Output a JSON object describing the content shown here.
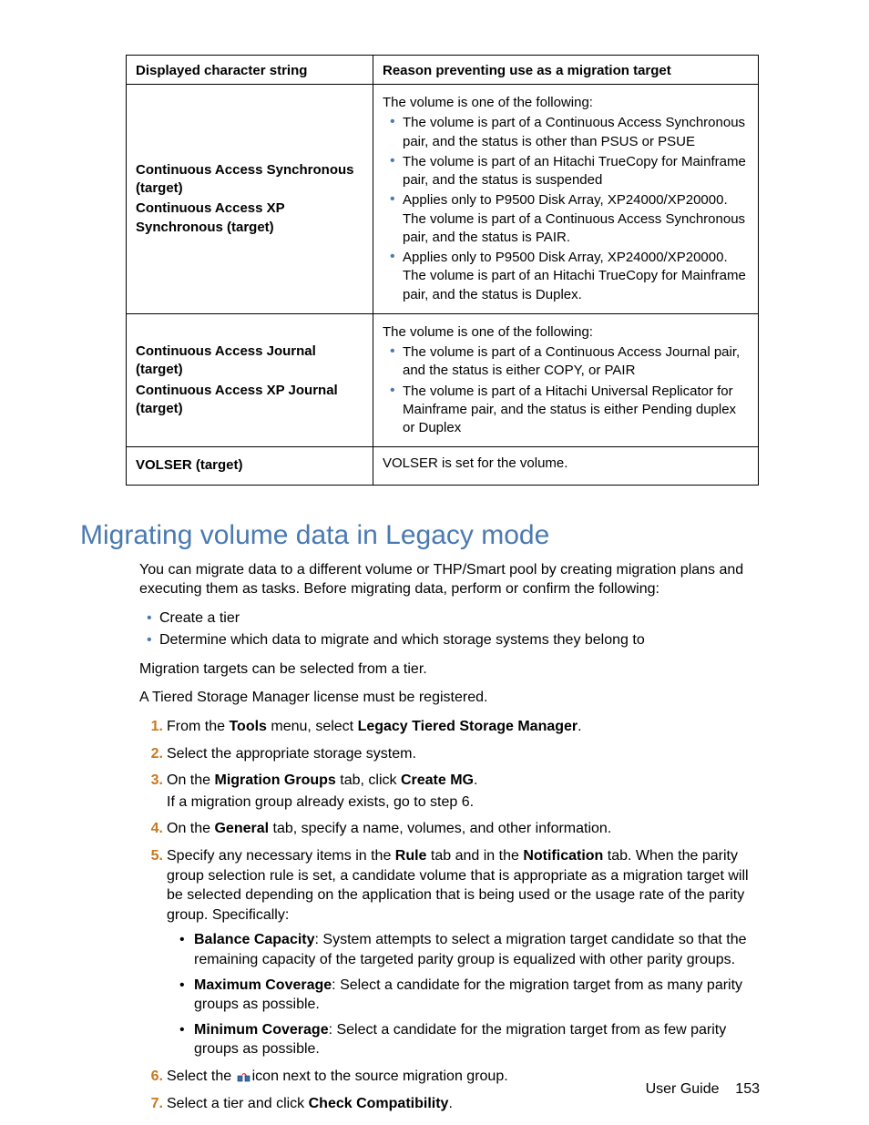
{
  "table": {
    "headers": [
      "Displayed character string",
      "Reason preventing use as a migration target"
    ],
    "rows": [
      {
        "col0_lines": [
          "Continuous Access Synchronous (target)",
          "Continuous Access XP Synchronous (target)"
        ],
        "col1_intro": "The volume is one of the following:",
        "col1_bullets": [
          "The volume is part of a Continuous Access Synchronous pair, and the status is other than PSUS or PSUE",
          "The volume is part of an Hitachi TrueCopy for Mainframe pair, and the status is suspended",
          "Applies only to P9500 Disk Array, XP24000/XP20000. The volume is part of a Continuous Access Synchronous pair, and the status is PAIR.",
          "Applies only to P9500 Disk Array, XP24000/XP20000. The volume is part of an Hitachi TrueCopy for Mainframe pair, and the status is Duplex."
        ]
      },
      {
        "col0_lines": [
          "Continuous Access Journal (target)",
          "Continuous Access XP Journal (target)"
        ],
        "col1_intro": "The volume is one of the following:",
        "col1_bullets": [
          "The volume is part of a Continuous Access Journal pair, and the status is either COPY, or PAIR",
          "The volume is part of a Hitachi Universal Replicator for Mainframe pair, and the status is either Pending duplex or Duplex"
        ]
      },
      {
        "col0_lines": [
          "VOLSER (target)"
        ],
        "col1_text": "VOLSER is set for the volume."
      }
    ]
  },
  "section_heading": "Migrating volume data in Legacy mode",
  "intro_para": "You can migrate data to a different volume or THP/Smart pool by creating migration plans and executing them as tasks. Before migrating data, perform or confirm the following:",
  "prereq_bullets": [
    "Create a tier",
    "Determine which data to migrate and which storage systems they belong to"
  ],
  "para2": "Migration targets can be selected from a tier.",
  "para3": "A Tiered Storage Manager license must be registered.",
  "steps": {
    "s1a": "From the ",
    "s1b": "Tools",
    "s1c": " menu, select ",
    "s1d": "Legacy Tiered Storage Manager",
    "s1e": ".",
    "s2": "Select the appropriate storage system.",
    "s3a": "On the ",
    "s3b": "Migration Groups",
    "s3c": " tab, click ",
    "s3d": "Create MG",
    "s3e": ".",
    "s3sub": "If a migration group already exists, go to step 6.",
    "s4a": "On the ",
    "s4b": "General",
    "s4c": " tab, specify a name, volumes, and other information.",
    "s5a": "Specify any necessary items in the ",
    "s5b": "Rule",
    "s5c": " tab and in the ",
    "s5d": "Notification",
    "s5e": " tab. When the parity group selection rule is set, a candidate volume that is appropriate as a migration target will be selected depending on the application that is being used or the usage rate of the parity group. Specifically:",
    "s5_b1a": "Balance Capacity",
    "s5_b1b": ": System attempts to select a migration target candidate so that the remaining capacity of the targeted parity group is equalized with other parity groups.",
    "s5_b2a": "Maximum Coverage",
    "s5_b2b": ": Select a candidate for the migration target from as many parity groups as possible.",
    "s5_b3a": "Minimum Coverage",
    "s5_b3b": ": Select a candidate for the migration target from as few parity groups as possible.",
    "s6a": "Select the ",
    "s6b": "icon next to the source migration group.",
    "s7a": "Select a tier and click ",
    "s7b": "Check Compatibility",
    "s7c": "."
  },
  "footer": {
    "label": "User Guide",
    "page": "153"
  }
}
